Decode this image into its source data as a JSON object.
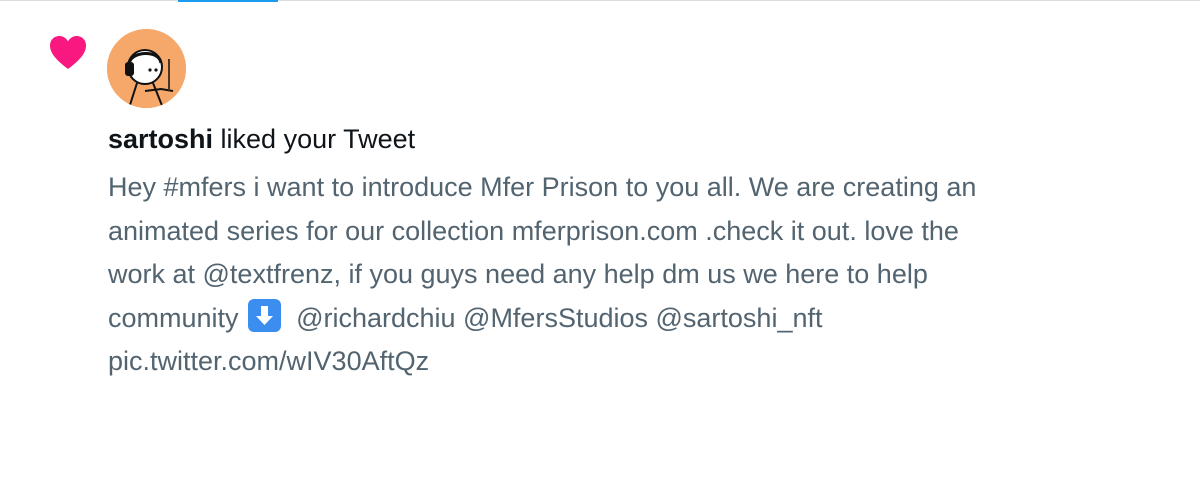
{
  "notification": {
    "type_icon": "heart-icon",
    "liker": "sartoshi",
    "action_text": " liked your Tweet",
    "tweet_lines": [
      "Hey #mfers i want to introduce Mfer Prison to you all. We are creating an",
      "animated series for our collection mferprison.com .check it out. love the",
      "work at @textfrenz, if you guys need any help dm us we here to help",
      "community",
      "@richardchiu @MfersStudios @sartoshi_nft",
      "pic.twitter.com/wIV30AftQz"
    ],
    "emoji": "down-arrow-emoji"
  },
  "colors": {
    "heart": "#f91880",
    "avatar_bg": "#f6a86a",
    "tab_accent": "#1d9bf0",
    "text_primary": "#0f1419",
    "text_secondary": "#536471"
  }
}
